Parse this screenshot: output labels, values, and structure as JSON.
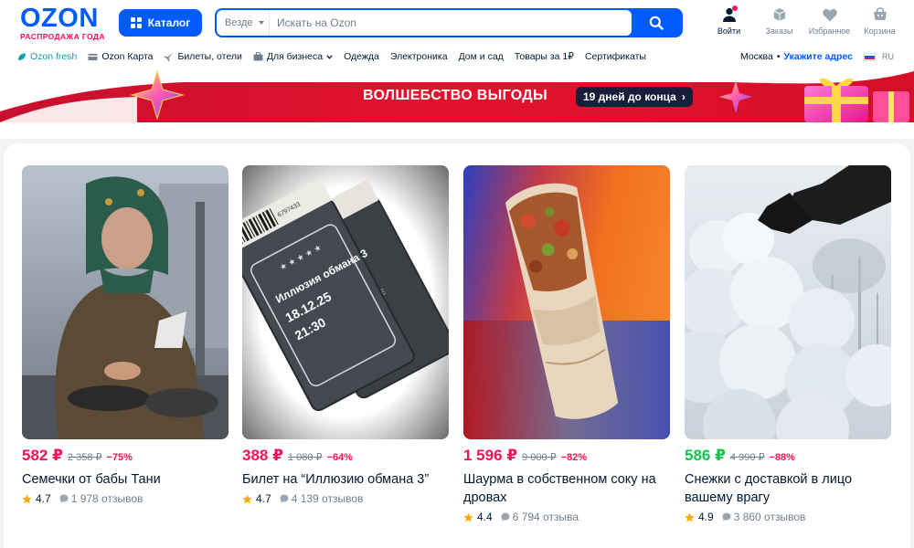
{
  "brand": {
    "logo": "OZON",
    "tagline": "РАСПРОДАЖА ГОДА",
    "primary_color": "#005bff",
    "accent_color": "#f91155"
  },
  "header": {
    "catalog_label": "Каталог",
    "search": {
      "scope": "Везде",
      "placeholder": "Искать на Ozon",
      "value": ""
    },
    "nav": [
      {
        "label": "Войти",
        "icon": "user-icon"
      },
      {
        "label": "Заказы",
        "icon": "box-icon"
      },
      {
        "label": "Избранное",
        "icon": "heart-icon"
      },
      {
        "label": "Корзина",
        "icon": "cart-icon"
      }
    ]
  },
  "subnav": {
    "links": [
      {
        "label": "Ozon fresh",
        "icon": "fresh-icon"
      },
      {
        "label": "Ozon Карта",
        "icon": "card-icon"
      },
      {
        "label": "Билеты, отели",
        "icon": "plane-icon"
      },
      {
        "label": "Для бизнеса",
        "icon": "briefcase-icon"
      },
      {
        "label": "Одежда"
      },
      {
        "label": "Электроника"
      },
      {
        "label": "Дом и сад"
      },
      {
        "label": "Товары за 1₽"
      },
      {
        "label": "Сертификаты"
      }
    ],
    "city": "Москва",
    "separator": "•",
    "address_link": "Укажите адрес",
    "language": "RU"
  },
  "banner": {
    "title": "ВОЛШЕБСТВО ВЫГОДЫ",
    "countdown": "19 дней до конца",
    "arrow": "›"
  },
  "products": [
    {
      "price": "582 ₽",
      "old_price": "2 358 ₽",
      "discount": "−75%",
      "title": "Семечки от бабы Тани",
      "rating": "4.7",
      "reviews": "1 978 отзывов",
      "image": "seeds-photo",
      "price_color": "#f91155"
    },
    {
      "price": "388 ₽",
      "old_price": "1 080 ₽",
      "discount": "−64%",
      "title": "Билет на “Иллюзию обмана 3”",
      "rating": "4.7",
      "reviews": "4 139 отзывов",
      "image": "tickets-photo",
      "ticket_text": [
        "Иллюзия обмана 3",
        "18.12.25",
        "21:30"
      ],
      "ticket_code": "6797433",
      "ticket_tag": "ONE",
      "price_color": "#f91155"
    },
    {
      "price": "1 596 ₽",
      "old_price": "9 000 ₽",
      "discount": "−82%",
      "title": "Шаурма в собственном соку на дровах",
      "rating": "4.4",
      "reviews": "6 794 отзыва",
      "image": "shawarma-photo",
      "price_color": "#f91155"
    },
    {
      "price": "586 ₽",
      "old_price": "4 990 ₽",
      "discount": "−88%",
      "title": "Снежки с доставкой в лицо вашему врагу",
      "rating": "4.9",
      "reviews": "3 860 отзывов",
      "image": "snowballs-photo",
      "price_color": "#10c44c"
    }
  ]
}
